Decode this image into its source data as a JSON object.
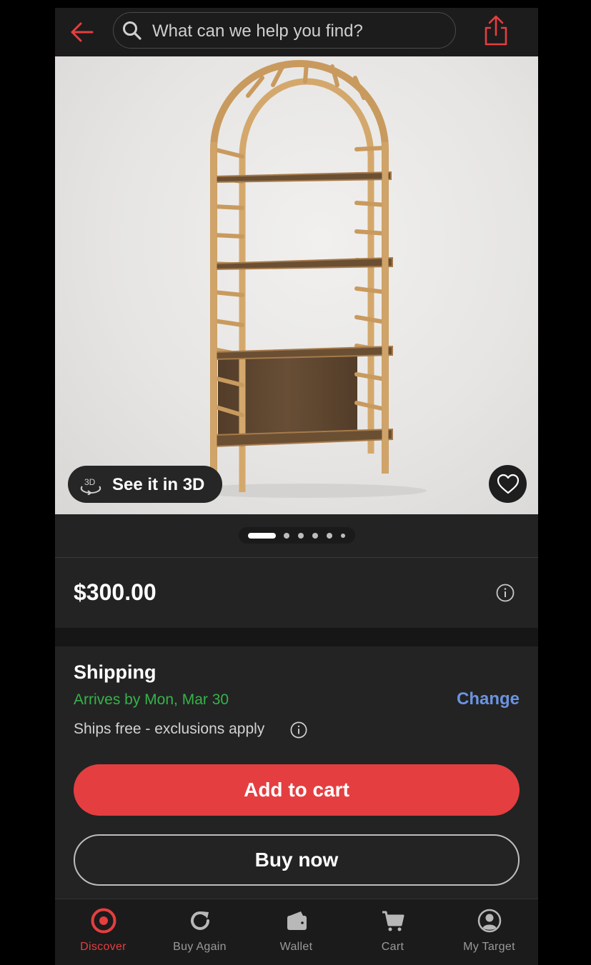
{
  "header": {
    "back_icon": "arrow-left-icon",
    "search_placeholder": "What can we help you find?",
    "share_icon": "share-icon"
  },
  "hero": {
    "see_3d_label": "See it in 3D",
    "see_3d_icon_text": "3D",
    "favorite_icon": "heart-icon",
    "pager": {
      "total": 6,
      "active_index": 0
    }
  },
  "product": {
    "price": "$300.00"
  },
  "shipping": {
    "title": "Shipping",
    "arrives": "Arrives by Mon, Mar 30",
    "change_label": "Change",
    "ships_free": "Ships free - exclusions apply"
  },
  "actions": {
    "add_to_cart": "Add to cart",
    "buy_now": "Buy now"
  },
  "nav": {
    "items": [
      {
        "label": "Discover",
        "icon": "target-logo-icon",
        "active": true
      },
      {
        "label": "Buy Again",
        "icon": "refresh-icon",
        "active": false
      },
      {
        "label": "Wallet",
        "icon": "wallet-icon",
        "active": false
      },
      {
        "label": "Cart",
        "icon": "cart-icon",
        "active": false
      },
      {
        "label": "My Target",
        "icon": "account-icon",
        "active": false
      }
    ]
  },
  "colors": {
    "accent_red": "#e53e40",
    "arrival_green": "#35b34a",
    "link_blue": "#6b93e0",
    "background": "#232323"
  }
}
